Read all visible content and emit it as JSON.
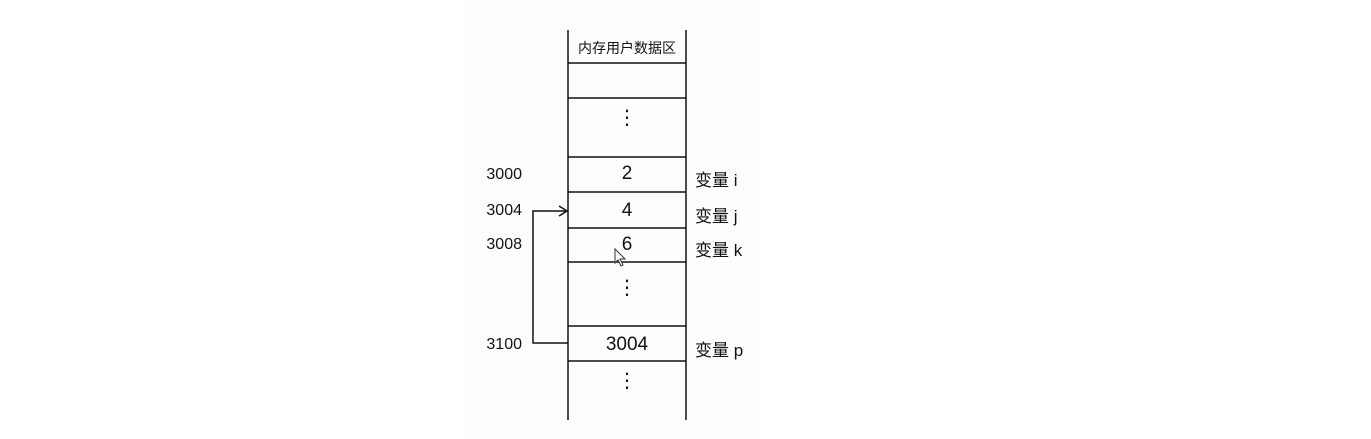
{
  "header": "内存用户数据区",
  "cells": [
    {
      "value": ""
    },
    {
      "value": "⋮"
    },
    {
      "address": "3000",
      "value": "2",
      "label": "变量 i"
    },
    {
      "address": "3004",
      "value": "4",
      "label": "变量 j"
    },
    {
      "address": "3008",
      "value": "6",
      "label": "变量 k"
    },
    {
      "value": "⋮"
    },
    {
      "address": "3100",
      "value": "3004",
      "label": "变量 p"
    },
    {
      "value": "⋮"
    }
  ]
}
